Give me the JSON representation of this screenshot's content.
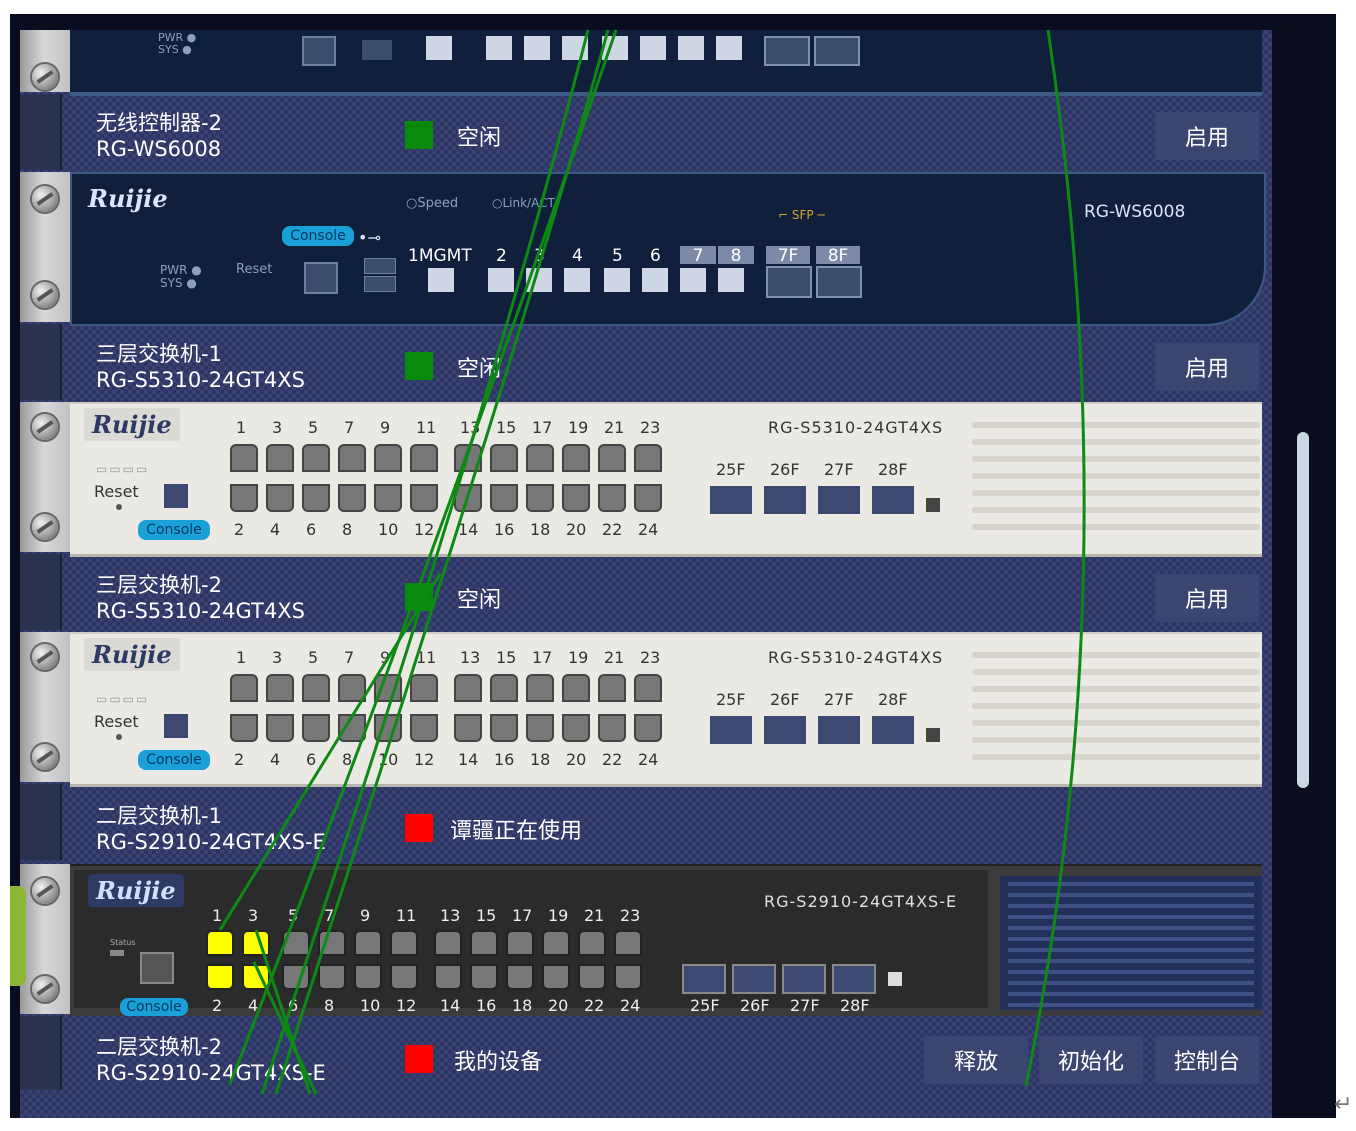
{
  "devices": [
    {
      "name": "无线控制器-2",
      "model": "RG-WS6008",
      "status": "空闲",
      "status_color": "#0a8a0a",
      "buttons": [
        "启用"
      ]
    },
    {
      "name": "三层交换机-1",
      "model": "RG-S5310-24GT4XS",
      "status": "空闲",
      "status_color": "#0a8a0a",
      "buttons": [
        "启用"
      ]
    },
    {
      "name": "三层交换机-2",
      "model": "RG-S5310-24GT4XS",
      "status": "空闲",
      "status_color": "#0a8a0a",
      "buttons": [
        "启用"
      ]
    },
    {
      "name": "二层交换机-1",
      "model": "RG-S2910-24GT4XS-E",
      "status": "谭疆正在使用",
      "status_color": "#ff0000",
      "buttons": []
    },
    {
      "name": "二层交换机-2",
      "model": "RG-S2910-24GT4XS-E",
      "status": "我的设备",
      "status_color": "#ff0000",
      "buttons": [
        "释放",
        "初始化",
        "控制台"
      ]
    }
  ],
  "panels": {
    "ws6008": {
      "brand": "Ruijie",
      "model": "RG-WS6008",
      "console": "Console",
      "reset": "Reset",
      "pwr": "PWR",
      "sys": "SYS",
      "speed": "Speed",
      "link": "Link/ACT",
      "sfp": "SFP",
      "mgmt": "1MGMT",
      "ports": [
        "2",
        "3",
        "4",
        "5",
        "6",
        "7",
        "8"
      ],
      "sfp_ports": [
        "7F",
        "8F"
      ]
    },
    "s5310": {
      "brand": "Ruijie",
      "model": "RG-S5310-24GT4XS",
      "console": "Console",
      "reset": "Reset",
      "top": [
        "1",
        "3",
        "5",
        "7",
        "9",
        "11",
        "13",
        "15",
        "17",
        "19",
        "21",
        "23"
      ],
      "bottom": [
        "2",
        "4",
        "6",
        "8",
        "10",
        "12",
        "14",
        "16",
        "18",
        "20",
        "22",
        "24"
      ],
      "sfp": [
        "25F",
        "26F",
        "27F",
        "28F"
      ]
    },
    "s2910": {
      "brand": "Ruijie",
      "model": "RG-S2910-24GT4XS-E",
      "console": "Console",
      "status_lbl": "Status",
      "top": [
        "1",
        "3",
        "5",
        "7",
        "9",
        "11",
        "13",
        "15",
        "17",
        "19",
        "21",
        "23"
      ],
      "bottom": [
        "2",
        "4",
        "6",
        "8",
        "10",
        "12",
        "14",
        "16",
        "18",
        "20",
        "22",
        "24"
      ],
      "sfp": [
        "25F",
        "26F",
        "27F",
        "28F"
      ],
      "active_ports": [
        "1",
        "2",
        "3",
        "4"
      ]
    }
  },
  "colors": {
    "background": "#2d3566",
    "cable": "#0d8a14",
    "button": "#3a4670",
    "active_port": "#ffff00"
  },
  "misc": {
    "return_glyph": "↵"
  }
}
